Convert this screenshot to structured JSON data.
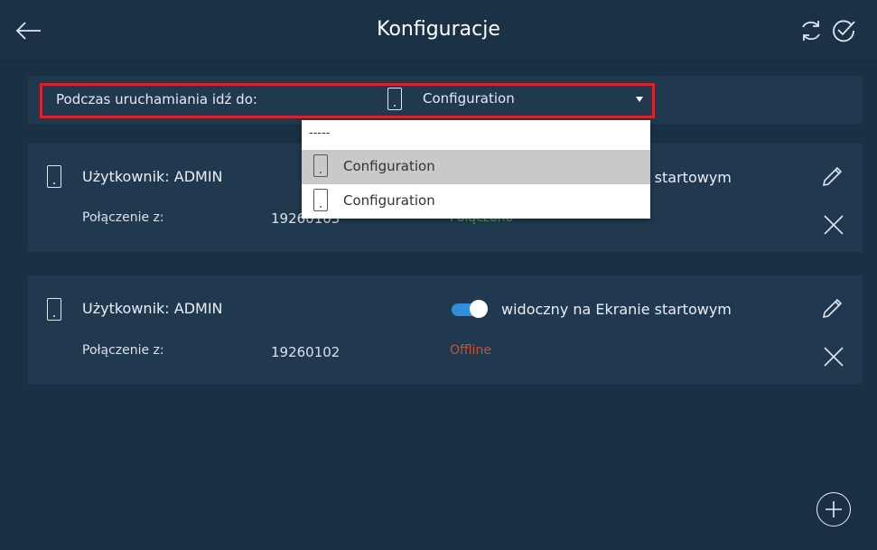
{
  "header": {
    "title": "Konfiguracje",
    "back_icon": "arrow-left-icon",
    "refresh_icon": "refresh-icon",
    "confirm_icon": "check-circle-icon"
  },
  "startup": {
    "label": "Podczas uruchamiania  idź do:",
    "selected_value": "Configuration",
    "options": [
      {
        "label": "-----"
      },
      {
        "label": "Configuration"
      },
      {
        "label": "Configuration"
      }
    ]
  },
  "cards": [
    {
      "user": "Użytkownik: ADMIN",
      "connection_label": "Połączenie z:",
      "connection_value": "19260103",
      "status": "Połączono",
      "visible_label": "widoczny na Ekranie startowym",
      "visible_on_startscreen": true
    },
    {
      "user": "Użytkownik: ADMIN",
      "connection_label": "Połączenie z:",
      "connection_value": "19260102",
      "status": "Offline",
      "visible_label": "widoczny na Ekranie startowym",
      "visible_on_startscreen": true
    }
  ],
  "colors": {
    "background": "#1a3145",
    "panel": "#21394e",
    "accent": "#2f8fdc",
    "highlight": "#d9232e",
    "status_online": "#52a35a",
    "status_offline": "#c2523b"
  }
}
